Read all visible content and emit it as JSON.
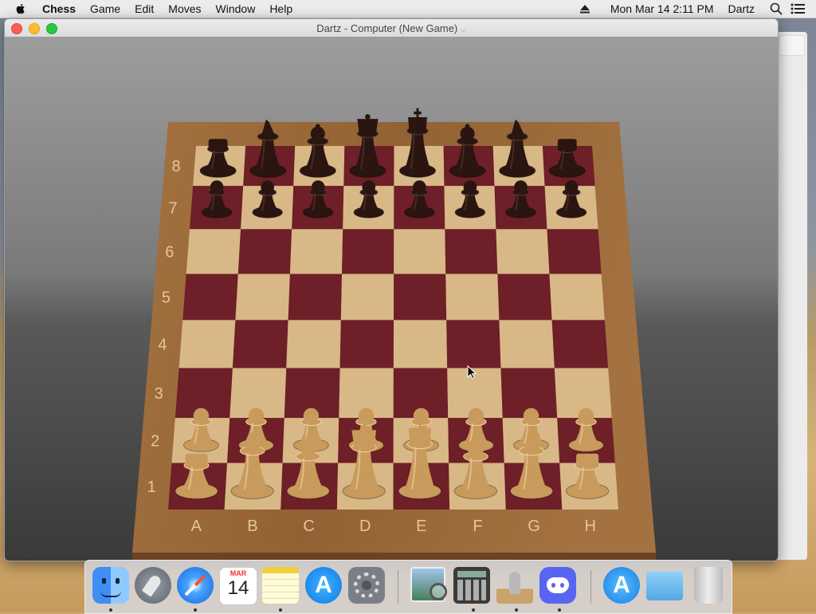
{
  "menubar": {
    "app_name": "Chess",
    "menus": [
      "Game",
      "Edit",
      "Moves",
      "Window",
      "Help"
    ],
    "datetime": "Mon Mar 14  2:11 PM",
    "user": "Dartz"
  },
  "window": {
    "title": "Dartz - Computer    (New Game)"
  },
  "board": {
    "ranks": [
      "8",
      "7",
      "6",
      "5",
      "4",
      "3",
      "2",
      "1"
    ],
    "files": [
      "A",
      "B",
      "C",
      "D",
      "E",
      "F",
      "G",
      "H"
    ],
    "black_back_rank": [
      "rook",
      "knight",
      "bishop",
      "queen",
      "king",
      "bishop",
      "knight",
      "rook"
    ],
    "white_back_rank": [
      "rook",
      "knight",
      "bishop",
      "queen",
      "king",
      "bishop",
      "knight",
      "rook"
    ],
    "colors": {
      "dark_square": "#6e1f27",
      "light_square": "#d9b887",
      "frame": "#9a6a3a",
      "black_piece": "#2a1510",
      "white_piece": "#c89a5c"
    }
  },
  "dock": {
    "calendar_month": "MAR",
    "calendar_day": "14",
    "items": [
      "finder-icon",
      "launchpad-icon",
      "safari-icon",
      "calendar-icon",
      "notes-icon",
      "app-store-icon",
      "system-preferences-icon",
      "preview-icon",
      "calculator-icon",
      "chess-icon",
      "discord-icon",
      "downloads-icon",
      "folder-icon",
      "trash-icon"
    ]
  }
}
